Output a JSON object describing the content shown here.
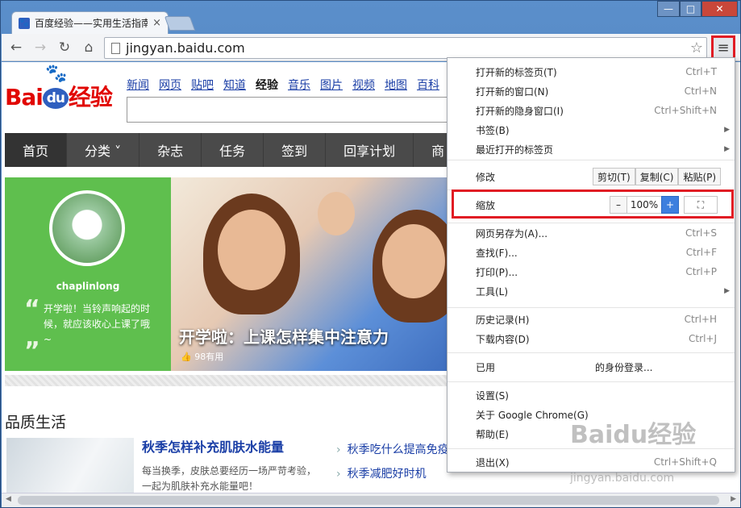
{
  "tab": {
    "title": "百度经验——实用生活指南",
    "close": "×"
  },
  "window": {
    "min": "—",
    "max": "□",
    "close": "✕"
  },
  "toolbar": {
    "back": "←",
    "forward": "→",
    "reload": "↻",
    "home": "⌂",
    "url": "jingyan.baidu.com",
    "star": "☆",
    "menu": "≡"
  },
  "page": {
    "logo": {
      "bai": "Bai",
      "du": "du",
      "jy": "经验"
    },
    "topnav": [
      "新闻",
      "网页",
      "贴吧",
      "知道",
      "经验",
      "音乐",
      "图片",
      "视频",
      "地图",
      "百科"
    ],
    "topnav_current": "经验",
    "nav": [
      "首页",
      "分类 ˅",
      "杂志",
      "任务",
      "签到",
      "回享计划",
      "商"
    ],
    "profile": {
      "name": "chaplinlong",
      "quote": "开学啦！当铃声响起的时候，就应该收心上课了哦~"
    },
    "hero": {
      "caption": "开学啦：上课怎样集中注意力",
      "likes": "98有用"
    },
    "section": "品质生活",
    "article": {
      "title": "秋季怎样补充肌肤水能量",
      "desc": "每当换季，皮肤总要经历一场严苛考验，一起为肌肤补充水能量吧！"
    },
    "related": [
      "秋季吃什么提高免疫",
      "秋季减肥好时机"
    ]
  },
  "menu": {
    "g1": [
      {
        "label": "打开新的标签页(T)",
        "shortcut": "Ctrl+T"
      },
      {
        "label": "打开新的窗口(N)",
        "shortcut": "Ctrl+N"
      },
      {
        "label": "打开新的隐身窗口(I)",
        "shortcut": "Ctrl+Shift+N"
      },
      {
        "label": "书签(B)",
        "shortcut": ""
      },
      {
        "label": "最近打开的标签页",
        "shortcut": ""
      }
    ],
    "edit": {
      "label": "修改",
      "cut": "剪切(T)",
      "copy": "复制(C)",
      "paste": "粘贴(P)"
    },
    "zoom": {
      "label": "缩放",
      "minus": "–",
      "value": "100%",
      "plus": "+",
      "fullscreen": "⛶"
    },
    "g2": [
      {
        "label": "网页另存为(A)...",
        "shortcut": "Ctrl+S"
      },
      {
        "label": "查找(F)...",
        "shortcut": "Ctrl+F"
      },
      {
        "label": "打印(P)...",
        "shortcut": "Ctrl+P"
      },
      {
        "label": "工具(L)",
        "shortcut": ""
      }
    ],
    "g3": [
      {
        "label": "历史记录(H)",
        "shortcut": "Ctrl+H"
      },
      {
        "label": "下载内容(D)",
        "shortcut": "Ctrl+J"
      }
    ],
    "signin": {
      "label": "已用",
      "suffix": "的身份登录..."
    },
    "g4": [
      {
        "label": "设置(S)",
        "shortcut": ""
      },
      {
        "label": "关于 Google Chrome(G)",
        "shortcut": ""
      },
      {
        "label": "帮助(E)",
        "shortcut": ""
      }
    ],
    "exit": {
      "label": "退出(X)",
      "shortcut": "Ctrl+Shift+Q"
    }
  },
  "watermark": {
    "main": "Baidu经验",
    "sub": "jingyan.baidu.com"
  }
}
